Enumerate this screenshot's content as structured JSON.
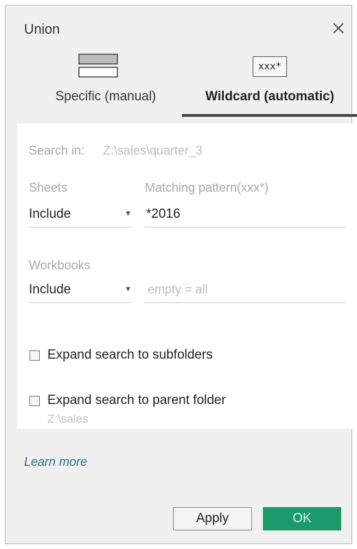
{
  "dialog": {
    "title": "Union",
    "close_icon": "close-icon"
  },
  "tabs": [
    {
      "label": "Specific (manual)",
      "icon": "table-rows-icon",
      "active": false
    },
    {
      "label": "Wildcard (automatic)",
      "icon_text": "xxx*",
      "active": true
    }
  ],
  "search": {
    "label": "Search in:",
    "path": "Z:\\sales\\quarter_3"
  },
  "sheets": {
    "label": "Sheets",
    "mode": "Include",
    "pattern_label": "Matching pattern(xxx*)",
    "pattern_value": "*2016"
  },
  "workbooks": {
    "label": "Workbooks",
    "mode": "Include",
    "pattern_placeholder": "empty = all"
  },
  "options": {
    "subfolders_label": "Expand search to subfolders",
    "subfolders_checked": false,
    "parent_label": "Expand search to parent folder",
    "parent_checked": false,
    "parent_path": "Z:\\sales"
  },
  "footer": {
    "learn_more": "Learn more",
    "apply_label": "Apply",
    "ok_label": "OK"
  },
  "colors": {
    "ok_button": "#1b9a6c",
    "link": "#2d6e8a",
    "active_tab_underline": "#444444"
  }
}
